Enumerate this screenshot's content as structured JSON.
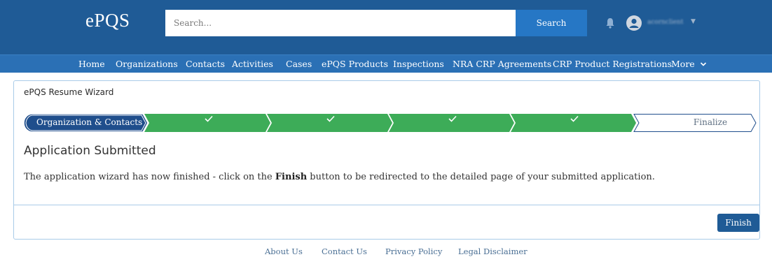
{
  "header": {
    "logo": "ePQS",
    "search": {
      "placeholder": "Search...",
      "button_label": "Search"
    },
    "user": {
      "name": "acornclient"
    }
  },
  "nav": {
    "items": [
      {
        "label": "Home"
      },
      {
        "label": "Organizations"
      },
      {
        "label": "Contacts"
      },
      {
        "label": "Activities"
      },
      {
        "label": "Cases"
      },
      {
        "label": "ePQS Products"
      },
      {
        "label": "Inspections"
      },
      {
        "label": "NRA CRP Agreements"
      },
      {
        "label": "CRP Product Registrations"
      },
      {
        "label": "More"
      }
    ]
  },
  "wizard": {
    "title": "ePQS Resume Wizard",
    "steps": [
      {
        "label": "Organization & Contacts",
        "state": "current"
      },
      {
        "label": "",
        "state": "complete",
        "icon": "check-icon"
      },
      {
        "label": "",
        "state": "complete",
        "icon": "check-icon"
      },
      {
        "label": "",
        "state": "complete",
        "icon": "check-icon"
      },
      {
        "label": "",
        "state": "complete",
        "icon": "check-icon"
      },
      {
        "label": "Finalize",
        "state": "incomplete"
      }
    ],
    "heading": "Application Submitted",
    "message": {
      "before": "The application wizard has now finished - click on the ",
      "bold": "Finish",
      "after": " button to be redirected to the detailed page of your submitted application."
    },
    "finish_label": "Finish"
  },
  "footer": {
    "links": [
      {
        "label": "About Us"
      },
      {
        "label": "Contact Us"
      },
      {
        "label": "Privacy Policy"
      },
      {
        "label": "Legal Disclaimer"
      }
    ]
  },
  "colors": {
    "header_bg": "#1f5b96",
    "nav_bg": "#2b70b5",
    "search_button": "#2677c5",
    "step_current": "#1f4e8c",
    "step_complete": "#3dac58",
    "card_border": "#a9cbe8",
    "finish_button": "#1f5b96"
  }
}
